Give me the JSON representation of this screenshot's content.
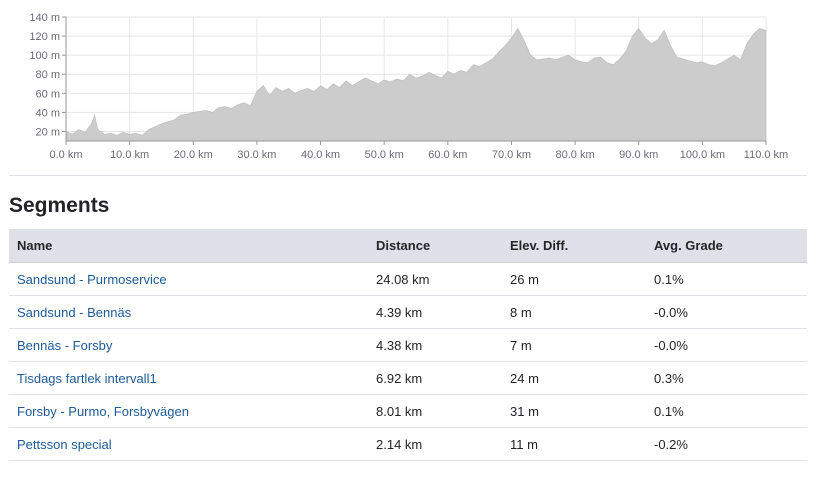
{
  "chart_data": {
    "type": "area",
    "title": "",
    "xlabel": "",
    "ylabel": "",
    "x_unit": "km",
    "y_unit": "m",
    "xlim": [
      0,
      110
    ],
    "ylim": [
      10,
      140
    ],
    "x_ticks": [
      0,
      10,
      20,
      30,
      40,
      50,
      60,
      70,
      80,
      90,
      100,
      110
    ],
    "x_tick_labels": [
      "0.0 km",
      "10.0 km",
      "20.0 km",
      "30.0 km",
      "40.0 km",
      "50.0 km",
      "60.0 km",
      "70.0 km",
      "80.0 km",
      "90.0 km",
      "100.0 km",
      "110.0 km"
    ],
    "y_ticks": [
      20,
      40,
      60,
      80,
      100,
      120,
      140
    ],
    "y_tick_labels": [
      "20 m",
      "40 m",
      "60 m",
      "80 m",
      "100 m",
      "120 m",
      "140 m"
    ],
    "grid": true,
    "legend": "none",
    "fill_color": "#cccccc",
    "series": [
      {
        "x": [
          0,
          1,
          2,
          3,
          4,
          4.5,
          5,
          6,
          7,
          8,
          9,
          10,
          11,
          12,
          13,
          14,
          15,
          16,
          17,
          18,
          19,
          20,
          21,
          22,
          23,
          24,
          25,
          26,
          27,
          28,
          29,
          30,
          31,
          32,
          33,
          34,
          35,
          36,
          37,
          38,
          39,
          40,
          41,
          42,
          43,
          44,
          45,
          46,
          47,
          48,
          49,
          50,
          51,
          52,
          53,
          54,
          55,
          56,
          57,
          58,
          59,
          60,
          61,
          62,
          63,
          64,
          65,
          66,
          67,
          68,
          69,
          70,
          71,
          72,
          73,
          74,
          75,
          76,
          77,
          78,
          79,
          80,
          81,
          82,
          83,
          84,
          85,
          86,
          87,
          88,
          89,
          90,
          91,
          92,
          93,
          94,
          95,
          96,
          97,
          98,
          99,
          100,
          101,
          102,
          103,
          104,
          105,
          106,
          107,
          108,
          109,
          110
        ],
        "y": [
          20,
          17,
          22,
          19,
          28,
          37,
          22,
          17,
          18,
          16,
          19,
          17,
          18,
          16,
          22,
          25,
          28,
          30,
          32,
          37,
          38,
          40,
          41,
          42,
          40,
          45,
          46,
          44,
          48,
          50,
          47,
          62,
          68,
          58,
          66,
          62,
          65,
          60,
          63,
          65,
          62,
          68,
          64,
          70,
          66,
          73,
          68,
          72,
          76,
          73,
          70,
          74,
          72,
          75,
          73,
          80,
          76,
          78,
          82,
          79,
          76,
          83,
          80,
          84,
          82,
          90,
          88,
          92,
          96,
          103,
          110,
          118,
          128,
          115,
          100,
          95,
          96,
          97,
          95,
          98,
          100,
          95,
          93,
          92,
          97,
          98,
          92,
          90,
          96,
          104,
          120,
          128,
          118,
          112,
          116,
          126,
          110,
          98,
          96,
          94,
          92,
          93,
          90,
          89,
          92,
          96,
          100,
          95,
          112,
          122,
          128,
          126
        ]
      }
    ]
  },
  "segments": {
    "title": "Segments",
    "columns": [
      "Name",
      "Distance",
      "Elev. Diff.",
      "Avg. Grade"
    ],
    "rows": [
      {
        "name": "Sandsund - Purmoservice",
        "distance": "24.08 km",
        "elev_diff": "26 m",
        "avg_grade": "0.1%"
      },
      {
        "name": "Sandsund - Bennäs",
        "distance": "4.39 km",
        "elev_diff": "8 m",
        "avg_grade": "-0.0%"
      },
      {
        "name": "Bennäs - Forsby",
        "distance": "4.38 km",
        "elev_diff": "7 m",
        "avg_grade": "-0.0%"
      },
      {
        "name": "Tisdags fartlek intervall1",
        "distance": "6.92 km",
        "elev_diff": "24 m",
        "avg_grade": "0.3%"
      },
      {
        "name": "Forsby - Purmo, Forsbyvägen",
        "distance": "8.01 km",
        "elev_diff": "31 m",
        "avg_grade": "0.1%"
      },
      {
        "name": "Pettsson special",
        "distance": "2.14 km",
        "elev_diff": "11 m",
        "avg_grade": "-0.2%"
      }
    ]
  }
}
